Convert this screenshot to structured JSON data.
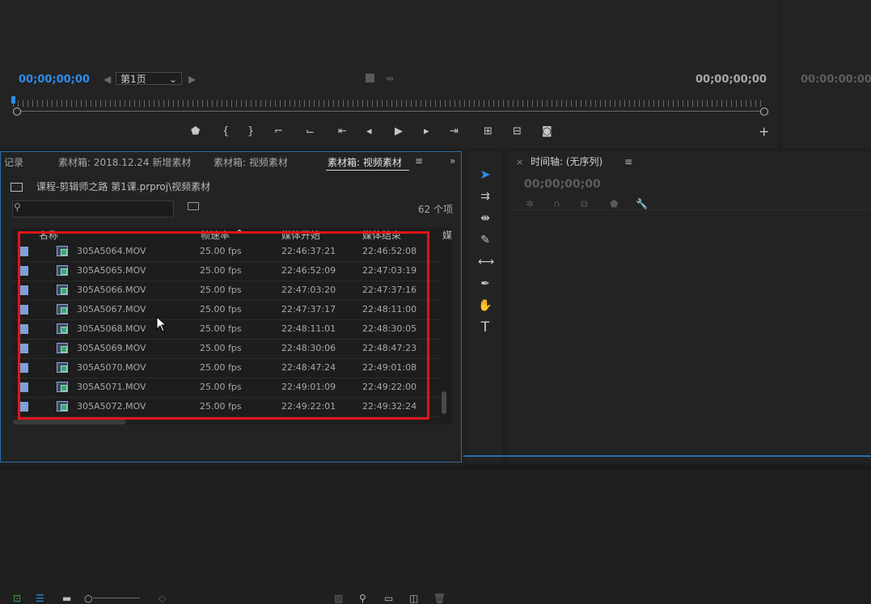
{
  "source_monitor": {
    "timecode_in": "00;00;00;00",
    "page_select": "第1页",
    "timecode_out": "00;00;00;00"
  },
  "program_monitor": {
    "timecode": "00:00:00:00"
  },
  "project_panel": {
    "tabs": [
      {
        "label": "记录"
      },
      {
        "label": "素材箱: 2018.12.24 新增素材"
      },
      {
        "label": "素材箱: 视频素材"
      },
      {
        "label": "素材箱: 视频素材"
      }
    ],
    "breadcrumb": "课程-剪辑师之路 第1课.prproj\\视频素材",
    "item_count": "62 个项",
    "columns": [
      "名称",
      "帧速率",
      "媒体开始",
      "媒体结束",
      "媒"
    ],
    "rows": [
      {
        "name": "305A5064.MOV",
        "fps": "25.00 fps",
        "start": "22:46:37:21",
        "end": "22:46:52:08"
      },
      {
        "name": "305A5065.MOV",
        "fps": "25.00 fps",
        "start": "22:46:52:09",
        "end": "22:47:03:19"
      },
      {
        "name": "305A5066.MOV",
        "fps": "25.00 fps",
        "start": "22:47:03:20",
        "end": "22:47:37:16"
      },
      {
        "name": "305A5067.MOV",
        "fps": "25.00 fps",
        "start": "22:47:37:17",
        "end": "22:48:11:00"
      },
      {
        "name": "305A5068.MOV",
        "fps": "25.00 fps",
        "start": "22:48:11:01",
        "end": "22:48:30:05"
      },
      {
        "name": "305A5069.MOV",
        "fps": "25.00 fps",
        "start": "22:48:30:06",
        "end": "22:48:47:23"
      },
      {
        "name": "305A5070.MOV",
        "fps": "25.00 fps",
        "start": "22:48:47:24",
        "end": "22:49:01:08"
      },
      {
        "name": "305A5071.MOV",
        "fps": "25.00 fps",
        "start": "22:49:01:09",
        "end": "22:49:22:00"
      },
      {
        "name": "305A5072.MOV",
        "fps": "25.00 fps",
        "start": "22:49:22:01",
        "end": "22:49:32:24"
      }
    ]
  },
  "timeline": {
    "title": "时间轴: (无序列)",
    "timecode": "00;00;00;00"
  },
  "colors": {
    "accent": "#2d8ceb",
    "highlight_box": "#e0151b",
    "panel_bg": "#232323"
  }
}
